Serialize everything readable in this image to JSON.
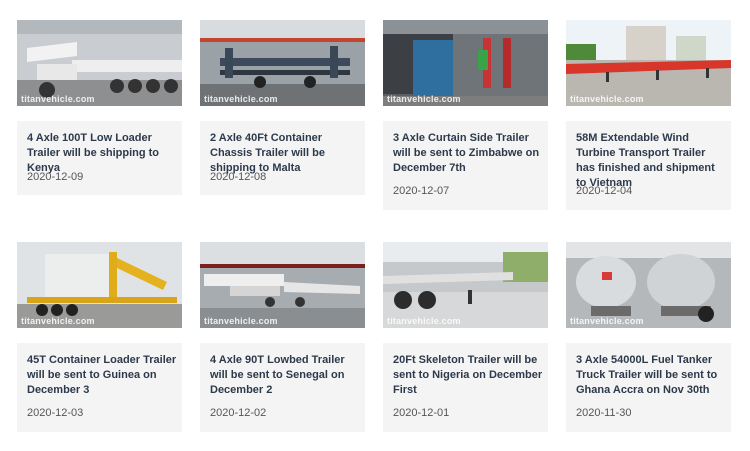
{
  "watermark": "titanvehicle.com",
  "items": [
    {
      "title": "4 Axle 100T Low Loader Trailer will be shipping to Kenya",
      "date": "2020-12-09"
    },
    {
      "title": "2 Axle 40Ft Container Chassis Trailer will be shipping to Malta",
      "date": "2020-12-08"
    },
    {
      "title": "3 Axle Curtain Side Trailer will be sent to Zimbabwe on December 7th",
      "date": "2020-12-07"
    },
    {
      "title": "58M Extendable Wind Turbine Transport Trailer has finished and shipment to Vietnam",
      "date": "2020-12-04"
    },
    {
      "title": "45T Container Loader Trailer will be sent to Guinea on December 3",
      "date": "2020-12-03"
    },
    {
      "title": "4 Axle 90T Lowbed Trailer will be sent to Senegal on December 2",
      "date": "2020-12-02"
    },
    {
      "title": "20Ft Skeleton Trailer will be sent to Nigeria on December First",
      "date": "2020-12-01"
    },
    {
      "title": "3 Axle 54000L Fuel Tanker Truck Trailer will be sent to Ghana Accra on Nov 30th",
      "date": "2020-11-30"
    }
  ]
}
